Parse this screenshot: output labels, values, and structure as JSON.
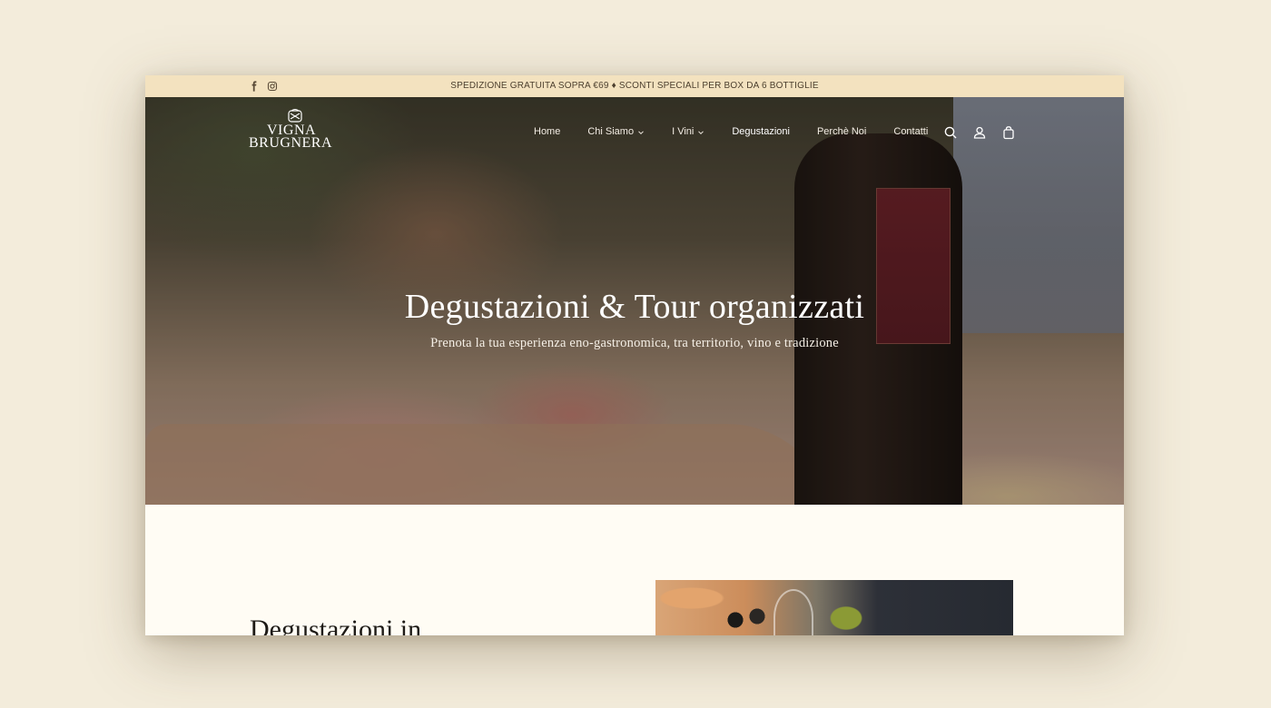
{
  "topbar": {
    "promo": "SPEDIZIONE GRATUITA SOPRA €69 ♦ SCONTI SPECIALI PER BOX DA 6 BOTTIGLIE",
    "social": [
      "facebook-icon",
      "instagram-icon"
    ]
  },
  "header": {
    "logo": {
      "line1": "VIGNA",
      "line2": "BRUGNERA"
    },
    "nav": [
      {
        "label": "Home",
        "dropdown": false
      },
      {
        "label": "Chi Siamo",
        "dropdown": true
      },
      {
        "label": "I Vini",
        "dropdown": true
      },
      {
        "label": "Degustazioni",
        "dropdown": false,
        "active": true
      },
      {
        "label": "Perchè Noi",
        "dropdown": false
      },
      {
        "label": "Contatti",
        "dropdown": false
      }
    ],
    "icons": [
      "search-icon",
      "account-icon",
      "cart-icon"
    ]
  },
  "hero": {
    "title": "Degustazioni & Tour organizzati",
    "subtitle": "Prenota la tua esperienza eno-gastronomica, tra territorio, vino e tradizione"
  },
  "section": {
    "title": "Degustazioni in"
  },
  "colors": {
    "page_bg": "#f3ecdb",
    "topbar_bg": "#f3e2bf",
    "content_bg": "#fffcf4",
    "text_dark": "#1d1a16"
  }
}
